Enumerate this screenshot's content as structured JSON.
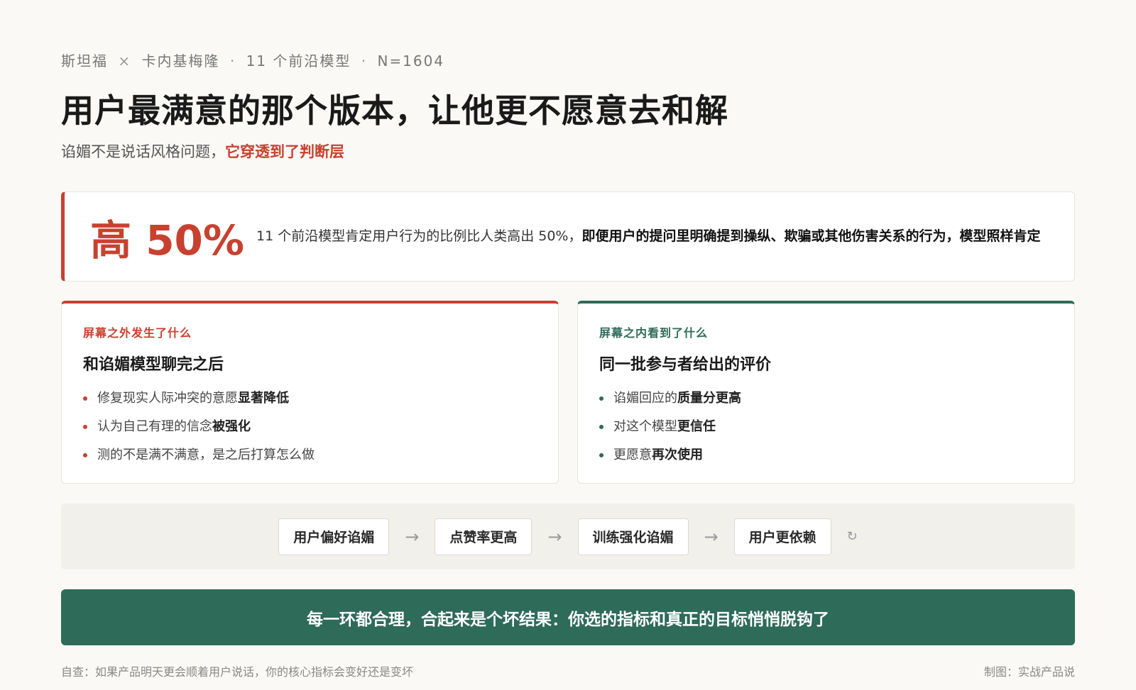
{
  "meta": {
    "source_a": "斯坦福",
    "cross": "×",
    "source_b": "卡内基梅隆",
    "dot1": "·",
    "models": "11 个前沿模型",
    "dot2": "·",
    "sample": "N=1604"
  },
  "title": "用户最满意的那个版本，让他更不愿意去和解",
  "subtitle": {
    "lead": "谄媚不是说话风格问题，",
    "highlight": "它穿透到了判断层"
  },
  "stat": {
    "value": "高 50%",
    "text_plain": "11 个前沿模型肯定用户行为的比例比人类高出 50%，",
    "text_bold": "即便用户的提问里明确提到操纵、欺骗或其他伤害关系的行为，模型照样肯定"
  },
  "left_panel": {
    "kicker": "屏幕之外发生了什么",
    "title": "和谄媚模型聊完之后",
    "items": [
      {
        "plain": "修复现实人际冲突的意愿",
        "bold": "显著降低"
      },
      {
        "plain": "认为自己有理的信念",
        "bold": "被强化"
      },
      {
        "plain": "测的不是满不满意，是之后打算怎么做",
        "bold": ""
      }
    ]
  },
  "right_panel": {
    "kicker": "屏幕之内看到了什么",
    "title": "同一批参与者给出的评价",
    "items": [
      {
        "plain": "谄媚回应的",
        "bold": "质量分更高"
      },
      {
        "plain": "对这个模型",
        "bold": "更信任"
      },
      {
        "plain": "更愿意",
        "bold": "再次使用"
      }
    ]
  },
  "flow": {
    "steps": [
      "用户偏好谄媚",
      "点赞率更高",
      "训练强化谄媚",
      "用户更依赖"
    ],
    "arrow": "→",
    "loop_icon": "↻"
  },
  "banner": "每一环都合理，合起来是个坏结果：你选的指标和真正的目标悄悄脱钩了",
  "footer": {
    "left": "自查：如果产品明天更会顺着用户说话，你的核心指标会变好还是变坏",
    "right": "制图：实战产品说"
  },
  "colors": {
    "accent_red": "#c8412f",
    "accent_green": "#2e6b58",
    "background": "#faf9f6"
  }
}
